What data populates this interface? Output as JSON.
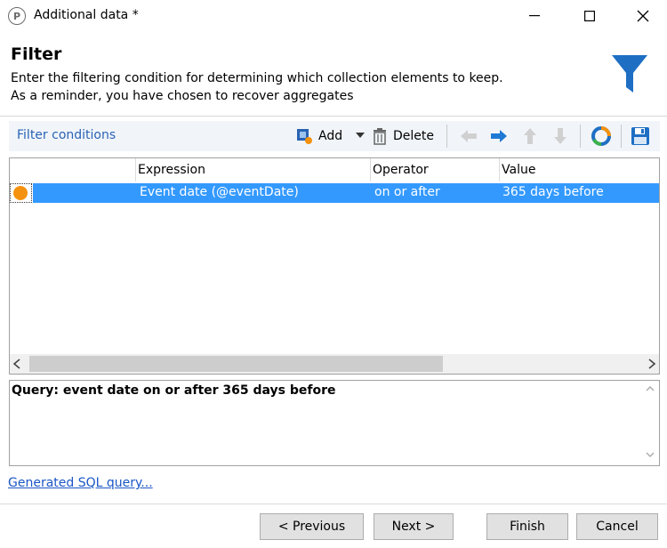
{
  "window": {
    "title": "Additional data *",
    "app_icon": "p-logo-icon"
  },
  "header": {
    "title": "Filter",
    "line1": "Enter the filtering condition for determining which collection elements to keep.",
    "line2": "As a reminder, you have chosen to recover aggregates"
  },
  "toolbar": {
    "label": "Filter conditions",
    "add_label": "Add",
    "delete_label": "Delete"
  },
  "grid": {
    "columns": [
      "Expression",
      "Operator",
      "Value"
    ],
    "rows": [
      {
        "expression": "Event date (@eventDate)",
        "operator": "on or after",
        "value": "365 days before"
      }
    ]
  },
  "query": {
    "text": "Query: event date on or after 365 days before"
  },
  "links": {
    "sql": "Generated SQL query..."
  },
  "buttons": {
    "previous": "< Previous",
    "next": "Next >",
    "finish": "Finish",
    "cancel": "Cancel"
  },
  "colors": {
    "accent": "#2a63b4",
    "selection": "#3399ff",
    "marker": "#f4920f",
    "funnel": "#1e6fc4"
  }
}
